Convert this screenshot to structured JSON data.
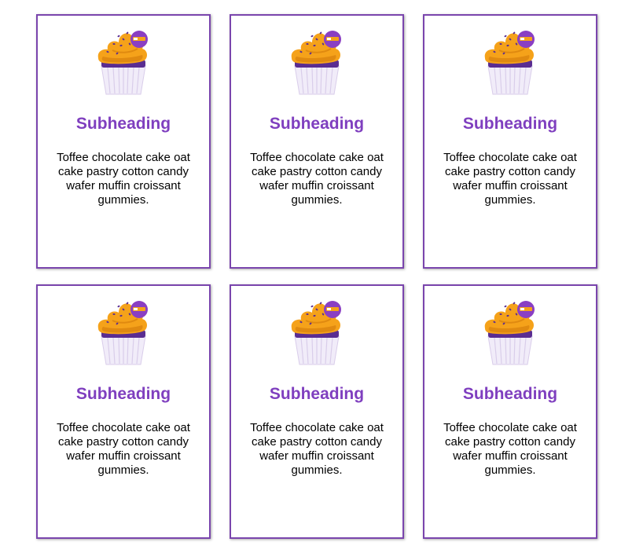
{
  "colors": {
    "border": "#7a45ad",
    "heading": "#7f3fbf",
    "frosting": "#f5a21a",
    "frosting_shade": "#e08a10",
    "cake": "#5a2d91",
    "wrapper": "#f1ecf9",
    "wrapper_line": "#d9cdea",
    "badge": "#8a3fc3"
  },
  "cards": [
    {
      "icon": "cupcake-icon",
      "subheading": "Subheading",
      "text": "Toffee chocolate cake oat cake pastry cotton candy wafer muffin croissant gummies."
    },
    {
      "icon": "cupcake-icon",
      "subheading": "Subheading",
      "text": "Toffee chocolate cake oat cake pastry cotton candy wafer muffin croissant gummies."
    },
    {
      "icon": "cupcake-icon",
      "subheading": "Subheading",
      "text": "Toffee chocolate cake oat cake pastry cotton candy wafer muffin croissant gummies."
    },
    {
      "icon": "cupcake-icon",
      "subheading": "Subheading",
      "text": "Toffee chocolate cake oat cake pastry cotton candy wafer muffin croissant gummies."
    },
    {
      "icon": "cupcake-icon",
      "subheading": "Subheading",
      "text": "Toffee chocolate cake oat cake pastry cotton candy wafer muffin croissant gummies."
    },
    {
      "icon": "cupcake-icon",
      "subheading": "Subheading",
      "text": "Toffee chocolate cake oat cake pastry cotton candy wafer muffin croissant gummies."
    }
  ]
}
